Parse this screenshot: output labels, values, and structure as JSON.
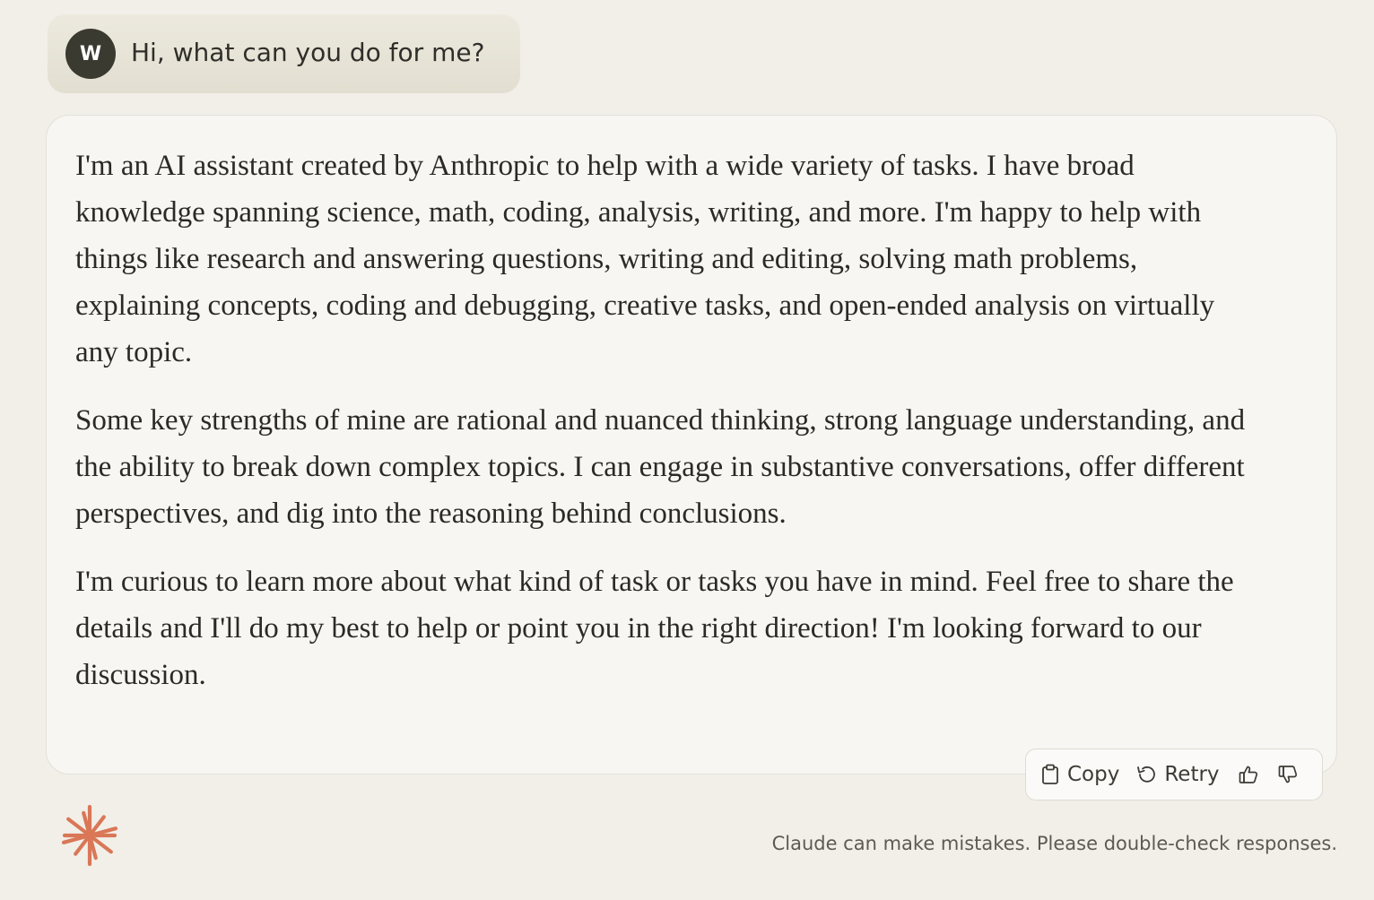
{
  "user_message": {
    "avatar_initial": "W",
    "text": "Hi, what can you do for me?"
  },
  "assistant_message": {
    "paragraphs": [
      "I'm an AI assistant created by Anthropic to help with a wide variety of tasks. I have broad knowledge spanning science, math, coding, analysis, writing, and more. I'm happy to help with things like research and answering questions, writing and editing, solving math problems, explaining concepts, coding and debugging, creative tasks, and open-ended analysis on virtually any topic.",
      "Some key strengths of mine are rational and nuanced thinking, strong language understanding, and the ability to break down complex topics. I can engage in substantive conversations, offer different perspectives, and dig into the reasoning behind conclusions.",
      "I'm curious to learn more about what kind of task or tasks you have in mind. Feel free to share the details and I'll do my best to help or point you in the right direction! I'm looking forward to our discussion."
    ]
  },
  "toolbar": {
    "copy_label": "Copy",
    "retry_label": "Retry"
  },
  "disclaimer": "Claude can make mistakes. Please double-check responses.",
  "colors": {
    "background": "#f1efe8",
    "user_bubble": "#e6e3d7",
    "avatar": "#3b3a30",
    "card": "#f7f6f3",
    "logo": "#d97757"
  },
  "icons": [
    "clipboard-icon",
    "retry-icon",
    "thumbs-up-icon",
    "thumbs-down-icon",
    "claude-logo-icon"
  ]
}
